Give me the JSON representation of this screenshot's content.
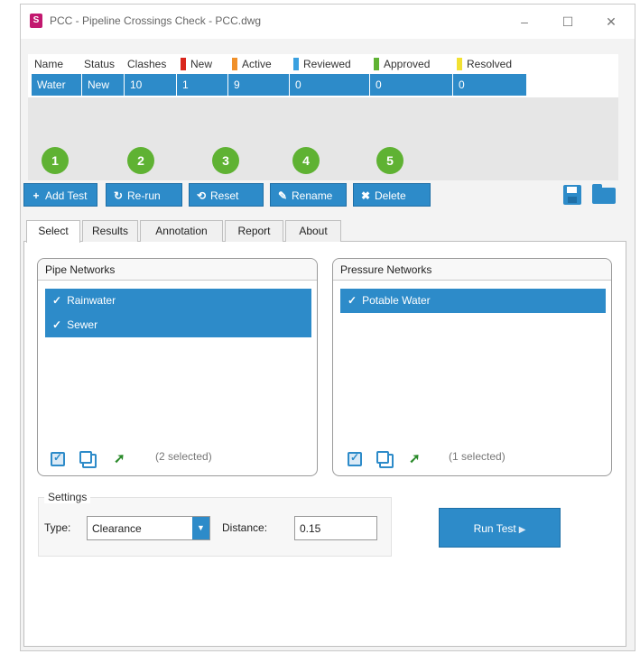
{
  "window": {
    "app_icon_letter": "S",
    "title": "PCC - Pipeline Crossings Check - PCC.dwg",
    "controls": {
      "minimize": "–",
      "maximize": "☐",
      "close": "✕"
    }
  },
  "grid": {
    "columns": [
      "Name",
      "Status",
      "Clashes",
      "New",
      "Active",
      "Reviewed",
      "Approved",
      "Resolved"
    ],
    "column_colors": {
      "New": "#d9261c",
      "Active": "#f0902a",
      "Reviewed": "#3aa0e0",
      "Approved": "#5fb233",
      "Resolved": "#f2e133"
    },
    "rows": [
      {
        "name": "Water",
        "status": "New",
        "clashes": "10",
        "new": "1",
        "active": "9",
        "reviewed": "0",
        "approved": "0",
        "resolved": "0"
      }
    ]
  },
  "badges": [
    "1",
    "2",
    "3",
    "4",
    "5"
  ],
  "toolbar": {
    "add_test": "Add Test",
    "rerun": "Re-run",
    "reset": "Reset",
    "rename": "Rename",
    "delete": "Delete",
    "icons": [
      "plus-icon",
      "rerun-icon",
      "reset-icon",
      "rename-icon",
      "delete-icon",
      "save-icon",
      "folder-icon"
    ]
  },
  "tabs": [
    {
      "label": "Select",
      "active": true
    },
    {
      "label": "Results",
      "active": false
    },
    {
      "label": "Annotation",
      "active": false
    },
    {
      "label": "Report",
      "active": false
    },
    {
      "label": "About",
      "active": false
    }
  ],
  "pipe_networks": {
    "title": "Pipe Networks",
    "items": [
      "Rainwater",
      "Sewer"
    ],
    "selected_count": "(2 selected)"
  },
  "pressure_networks": {
    "title": "Pressure Networks",
    "items": [
      "Potable Water"
    ],
    "selected_count": "(1 selected)"
  },
  "settings": {
    "title": "Settings",
    "type_label": "Type:",
    "type_value": "Clearance",
    "distance_label": "Distance:",
    "distance_value": "0.15"
  },
  "run_test": "Run Test",
  "accent_color": "#2d8bc9",
  "badge_color": "#5fb233"
}
